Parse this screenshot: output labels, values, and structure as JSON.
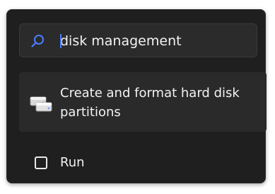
{
  "search": {
    "query": "disk management",
    "icon": "search-icon"
  },
  "results": [
    {
      "label": "Create and format hard disk partitions",
      "icon": "disk-management-icon"
    }
  ],
  "run": {
    "label": "Run",
    "icon": "run-icon"
  },
  "colors": {
    "panel_background": "#1f1f1f",
    "search_background": "#2b2b2b",
    "highlight_background": "#2a2a2a",
    "text": "#f2f2f2",
    "accent": "#4c7dff"
  }
}
